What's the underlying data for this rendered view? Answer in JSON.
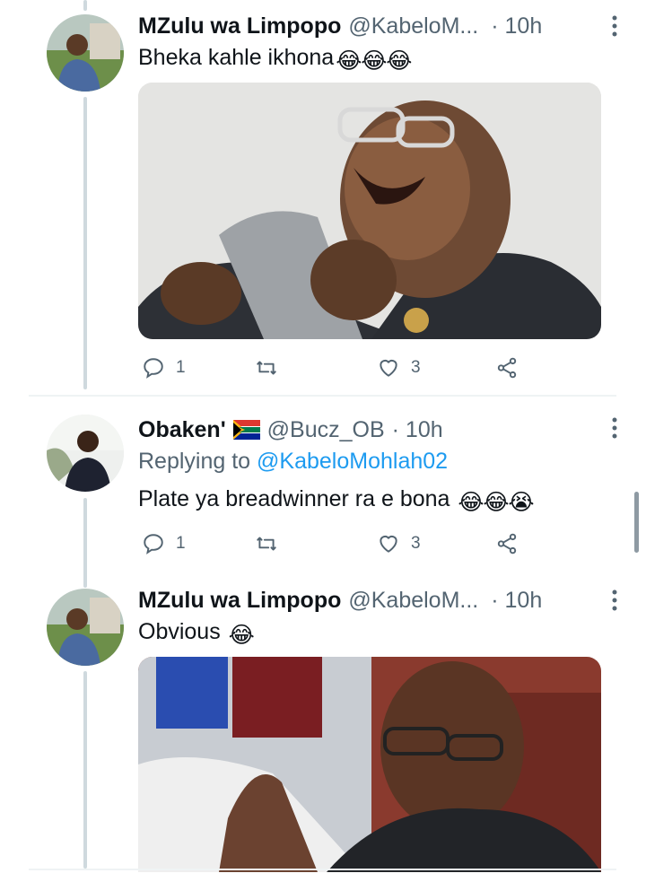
{
  "tweets": [
    {
      "name": "MZulu wa Limpopo",
      "handle": "@KabeloM...",
      "time": "· 10h",
      "text": "Bheka kahle ikhona",
      "emojis": [
        "😂",
        "😂",
        "😂"
      ],
      "actions": {
        "reply_count": "1",
        "retweet_count": "",
        "like_count": "3"
      }
    },
    {
      "name": "Obaken'",
      "flag": "South Africa flag",
      "handle": "@Bucz_OB",
      "time": "· 10h",
      "replying_prefix": "Replying to",
      "replying_to": "@KabeloMohlah02",
      "text": "Plate ya breadwinner ra e bona",
      "emojis": [
        "😂",
        "😂",
        "😭"
      ],
      "actions": {
        "reply_count": "1",
        "retweet_count": "",
        "like_count": "3"
      }
    },
    {
      "name": "MZulu wa Limpopo",
      "handle": "@KabeloM...",
      "time": "· 10h",
      "text": "Obvious",
      "emojis": [
        "😂"
      ]
    }
  ],
  "icons": {
    "reply": "reply-icon",
    "retweet": "retweet-icon",
    "like": "heart-icon",
    "share": "share-icon",
    "more": "more-options-icon"
  },
  "colors": {
    "accent": "#1d9bf0",
    "secondary_text": "#536471",
    "thread_line": "#cfd9de"
  }
}
